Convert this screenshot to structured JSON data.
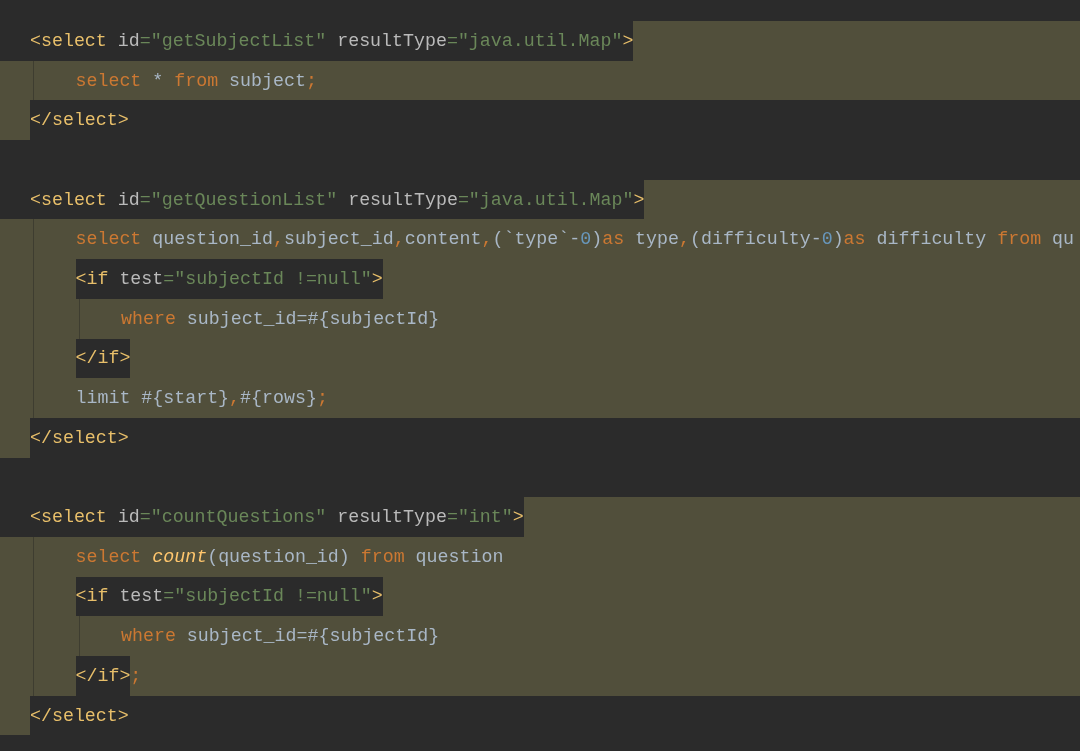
{
  "editor": {
    "blocks": [
      {
        "injected": true,
        "open": [
          {
            "kind": "tag",
            "text": "<select"
          },
          {
            "kind": "attr",
            "text": " id"
          },
          {
            "kind": "value",
            "text": "=\"getSubjectList\""
          },
          {
            "kind": "attr",
            "text": " resultType"
          },
          {
            "kind": "value",
            "text": "=\"java.util.Map\""
          },
          {
            "kind": "tag",
            "text": ">"
          }
        ],
        "body": [
          {
            "tokens": [
              {
                "kind": "keyword",
                "text": "select"
              },
              {
                "kind": "ident",
                "text": " * "
              },
              {
                "kind": "keyword",
                "text": "from"
              },
              {
                "kind": "ident",
                "text": " subject"
              },
              {
                "kind": "punct",
                "text": ";"
              }
            ]
          }
        ],
        "close": [
          {
            "kind": "tag",
            "text": "</select>"
          }
        ]
      },
      {
        "injected": true,
        "open": [
          {
            "kind": "tag",
            "text": "<select"
          },
          {
            "kind": "attr",
            "text": " id"
          },
          {
            "kind": "value",
            "text": "=\"getQuestionList\""
          },
          {
            "kind": "attr",
            "text": " resultType"
          },
          {
            "kind": "value",
            "text": "=\"java.util.Map\""
          },
          {
            "kind": "tag",
            "text": ">"
          }
        ],
        "body": [
          {
            "tokens": [
              {
                "kind": "keyword",
                "text": "select"
              },
              {
                "kind": "ident",
                "text": " question_id"
              },
              {
                "kind": "punct",
                "text": ","
              },
              {
                "kind": "ident",
                "text": "subject_id"
              },
              {
                "kind": "punct",
                "text": ","
              },
              {
                "kind": "ident",
                "text": "content"
              },
              {
                "kind": "punct",
                "text": ","
              },
              {
                "kind": "ident",
                "text": "(`type`-"
              },
              {
                "kind": "number",
                "text": "0"
              },
              {
                "kind": "ident",
                "text": ")"
              },
              {
                "kind": "keyword",
                "text": "as"
              },
              {
                "kind": "ident",
                "text": " type"
              },
              {
                "kind": "punct",
                "text": ","
              },
              {
                "kind": "ident",
                "text": "(difficulty-"
              },
              {
                "kind": "number",
                "text": "0"
              },
              {
                "kind": "ident",
                "text": ")"
              },
              {
                "kind": "keyword",
                "text": "as"
              },
              {
                "kind": "ident",
                "text": " difficulty "
              },
              {
                "kind": "keyword",
                "text": "from"
              },
              {
                "kind": "ident",
                "text": " qu"
              }
            ]
          },
          {
            "open": [
              {
                "kind": "tag",
                "text": "<if"
              },
              {
                "kind": "attr",
                "text": " test"
              },
              {
                "kind": "value",
                "text": "=\"subjectId !=null\""
              },
              {
                "kind": "tag",
                "text": ">"
              }
            ],
            "body": [
              {
                "tokens": [
                  {
                    "kind": "keyword",
                    "text": "where"
                  },
                  {
                    "kind": "ident",
                    "text": " subject_id=#{subjectId}"
                  }
                ]
              }
            ],
            "close": [
              {
                "kind": "tag",
                "text": "</if>"
              }
            ]
          },
          {
            "tokens": [
              {
                "kind": "ident",
                "text": "limit #{start}"
              },
              {
                "kind": "punct",
                "text": ","
              },
              {
                "kind": "ident",
                "text": "#{rows}"
              },
              {
                "kind": "punct",
                "text": ";"
              }
            ]
          }
        ],
        "close": [
          {
            "kind": "tag",
            "text": "</select>"
          }
        ]
      },
      {
        "injected": true,
        "open": [
          {
            "kind": "tag",
            "text": "<select"
          },
          {
            "kind": "attr",
            "text": " id"
          },
          {
            "kind": "value",
            "text": "=\"countQuestions\""
          },
          {
            "kind": "attr",
            "text": " resultType"
          },
          {
            "kind": "value",
            "text": "=\"int\""
          },
          {
            "kind": "tag",
            "text": ">"
          }
        ],
        "body": [
          {
            "tokens": [
              {
                "kind": "keyword",
                "text": "select "
              },
              {
                "kind": "function",
                "text": "count"
              },
              {
                "kind": "ident",
                "text": "(question_id) "
              },
              {
                "kind": "keyword",
                "text": "from"
              },
              {
                "kind": "ident",
                "text": " question"
              }
            ]
          },
          {
            "open": [
              {
                "kind": "tag",
                "text": "<if"
              },
              {
                "kind": "attr",
                "text": " test"
              },
              {
                "kind": "value",
                "text": "=\"subjectId !=null\""
              },
              {
                "kind": "tag",
                "text": ">"
              }
            ],
            "body": [
              {
                "tokens": [
                  {
                    "kind": "keyword",
                    "text": "where"
                  },
                  {
                    "kind": "ident",
                    "text": " subject_id=#{subjectId}"
                  }
                ]
              }
            ],
            "close": [
              {
                "kind": "tag",
                "text": "</if>"
              },
              {
                "kind": "punct",
                "text": ";"
              }
            ]
          }
        ],
        "close": [
          {
            "kind": "tag",
            "text": "</select>"
          }
        ]
      }
    ]
  }
}
